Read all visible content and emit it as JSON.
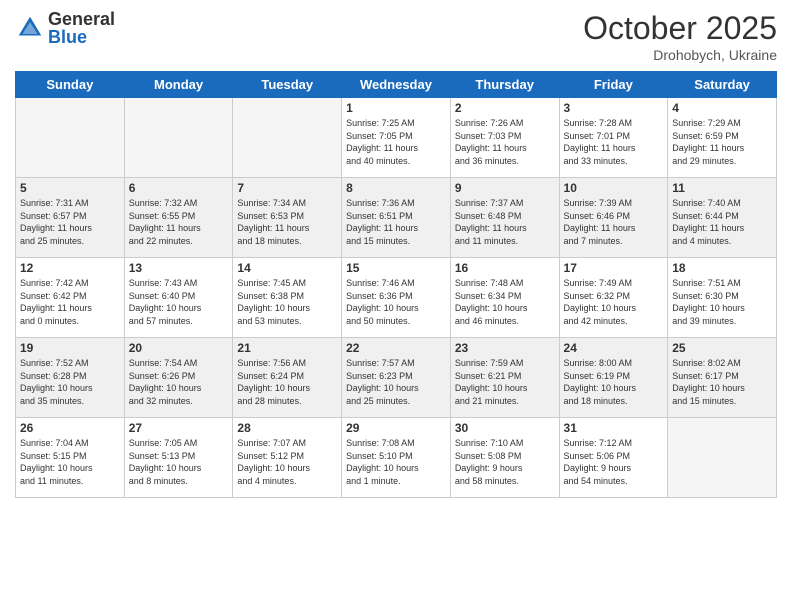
{
  "header": {
    "logo_general": "General",
    "logo_blue": "Blue",
    "month": "October 2025",
    "location": "Drohobych, Ukraine"
  },
  "days_of_week": [
    "Sunday",
    "Monday",
    "Tuesday",
    "Wednesday",
    "Thursday",
    "Friday",
    "Saturday"
  ],
  "weeks": [
    [
      {
        "num": "",
        "info": ""
      },
      {
        "num": "",
        "info": ""
      },
      {
        "num": "",
        "info": ""
      },
      {
        "num": "1",
        "info": "Sunrise: 7:25 AM\nSunset: 7:05 PM\nDaylight: 11 hours\nand 40 minutes."
      },
      {
        "num": "2",
        "info": "Sunrise: 7:26 AM\nSunset: 7:03 PM\nDaylight: 11 hours\nand 36 minutes."
      },
      {
        "num": "3",
        "info": "Sunrise: 7:28 AM\nSunset: 7:01 PM\nDaylight: 11 hours\nand 33 minutes."
      },
      {
        "num": "4",
        "info": "Sunrise: 7:29 AM\nSunset: 6:59 PM\nDaylight: 11 hours\nand 29 minutes."
      }
    ],
    [
      {
        "num": "5",
        "info": "Sunrise: 7:31 AM\nSunset: 6:57 PM\nDaylight: 11 hours\nand 25 minutes."
      },
      {
        "num": "6",
        "info": "Sunrise: 7:32 AM\nSunset: 6:55 PM\nDaylight: 11 hours\nand 22 minutes."
      },
      {
        "num": "7",
        "info": "Sunrise: 7:34 AM\nSunset: 6:53 PM\nDaylight: 11 hours\nand 18 minutes."
      },
      {
        "num": "8",
        "info": "Sunrise: 7:36 AM\nSunset: 6:51 PM\nDaylight: 11 hours\nand 15 minutes."
      },
      {
        "num": "9",
        "info": "Sunrise: 7:37 AM\nSunset: 6:48 PM\nDaylight: 11 hours\nand 11 minutes."
      },
      {
        "num": "10",
        "info": "Sunrise: 7:39 AM\nSunset: 6:46 PM\nDaylight: 11 hours\nand 7 minutes."
      },
      {
        "num": "11",
        "info": "Sunrise: 7:40 AM\nSunset: 6:44 PM\nDaylight: 11 hours\nand 4 minutes."
      }
    ],
    [
      {
        "num": "12",
        "info": "Sunrise: 7:42 AM\nSunset: 6:42 PM\nDaylight: 11 hours\nand 0 minutes."
      },
      {
        "num": "13",
        "info": "Sunrise: 7:43 AM\nSunset: 6:40 PM\nDaylight: 10 hours\nand 57 minutes."
      },
      {
        "num": "14",
        "info": "Sunrise: 7:45 AM\nSunset: 6:38 PM\nDaylight: 10 hours\nand 53 minutes."
      },
      {
        "num": "15",
        "info": "Sunrise: 7:46 AM\nSunset: 6:36 PM\nDaylight: 10 hours\nand 50 minutes."
      },
      {
        "num": "16",
        "info": "Sunrise: 7:48 AM\nSunset: 6:34 PM\nDaylight: 10 hours\nand 46 minutes."
      },
      {
        "num": "17",
        "info": "Sunrise: 7:49 AM\nSunset: 6:32 PM\nDaylight: 10 hours\nand 42 minutes."
      },
      {
        "num": "18",
        "info": "Sunrise: 7:51 AM\nSunset: 6:30 PM\nDaylight: 10 hours\nand 39 minutes."
      }
    ],
    [
      {
        "num": "19",
        "info": "Sunrise: 7:52 AM\nSunset: 6:28 PM\nDaylight: 10 hours\nand 35 minutes."
      },
      {
        "num": "20",
        "info": "Sunrise: 7:54 AM\nSunset: 6:26 PM\nDaylight: 10 hours\nand 32 minutes."
      },
      {
        "num": "21",
        "info": "Sunrise: 7:56 AM\nSunset: 6:24 PM\nDaylight: 10 hours\nand 28 minutes."
      },
      {
        "num": "22",
        "info": "Sunrise: 7:57 AM\nSunset: 6:23 PM\nDaylight: 10 hours\nand 25 minutes."
      },
      {
        "num": "23",
        "info": "Sunrise: 7:59 AM\nSunset: 6:21 PM\nDaylight: 10 hours\nand 21 minutes."
      },
      {
        "num": "24",
        "info": "Sunrise: 8:00 AM\nSunset: 6:19 PM\nDaylight: 10 hours\nand 18 minutes."
      },
      {
        "num": "25",
        "info": "Sunrise: 8:02 AM\nSunset: 6:17 PM\nDaylight: 10 hours\nand 15 minutes."
      }
    ],
    [
      {
        "num": "26",
        "info": "Sunrise: 7:04 AM\nSunset: 5:15 PM\nDaylight: 10 hours\nand 11 minutes."
      },
      {
        "num": "27",
        "info": "Sunrise: 7:05 AM\nSunset: 5:13 PM\nDaylight: 10 hours\nand 8 minutes."
      },
      {
        "num": "28",
        "info": "Sunrise: 7:07 AM\nSunset: 5:12 PM\nDaylight: 10 hours\nand 4 minutes."
      },
      {
        "num": "29",
        "info": "Sunrise: 7:08 AM\nSunset: 5:10 PM\nDaylight: 10 hours\nand 1 minute."
      },
      {
        "num": "30",
        "info": "Sunrise: 7:10 AM\nSunset: 5:08 PM\nDaylight: 9 hours\nand 58 minutes."
      },
      {
        "num": "31",
        "info": "Sunrise: 7:12 AM\nSunset: 5:06 PM\nDaylight: 9 hours\nand 54 minutes."
      },
      {
        "num": "",
        "info": ""
      }
    ]
  ]
}
